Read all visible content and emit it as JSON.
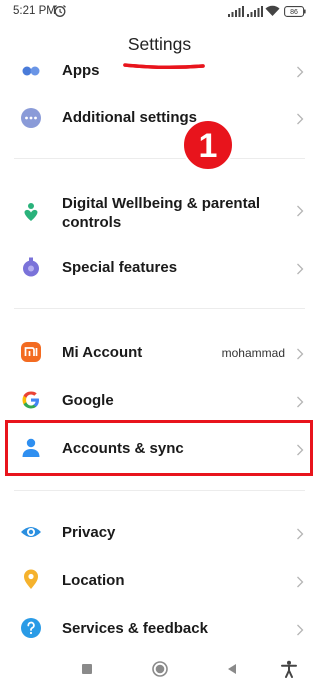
{
  "status_bar": {
    "time": "5:21 PM",
    "battery": "86"
  },
  "header": {
    "title": "Settings"
  },
  "annotation": {
    "step_number": "1",
    "accent_color": "#e8141c"
  },
  "rows": {
    "apps": {
      "label": "Apps",
      "icon": "apps-icon"
    },
    "additional_settings": {
      "label": "Additional settings",
      "icon": "more-dots-icon"
    },
    "digital_wellbeing": {
      "label": "Digital Wellbeing & parental controls",
      "icon": "wellbeing-icon"
    },
    "special_features": {
      "label": "Special features",
      "icon": "special-features-icon"
    },
    "mi_account": {
      "label": "Mi Account",
      "value": "mohammad",
      "icon": "mi-logo-icon"
    },
    "google": {
      "label": "Google",
      "icon": "google-logo-icon"
    },
    "accounts_sync": {
      "label": "Accounts & sync",
      "icon": "person-icon"
    },
    "privacy": {
      "label": "Privacy",
      "icon": "eye-icon"
    },
    "location": {
      "label": "Location",
      "icon": "location-pin-icon"
    },
    "services_feedback": {
      "label": "Services & feedback",
      "icon": "help-icon"
    }
  },
  "nav": {
    "buttons": [
      "recents-icon",
      "home-icon",
      "back-icon",
      "accessibility-icon"
    ]
  }
}
